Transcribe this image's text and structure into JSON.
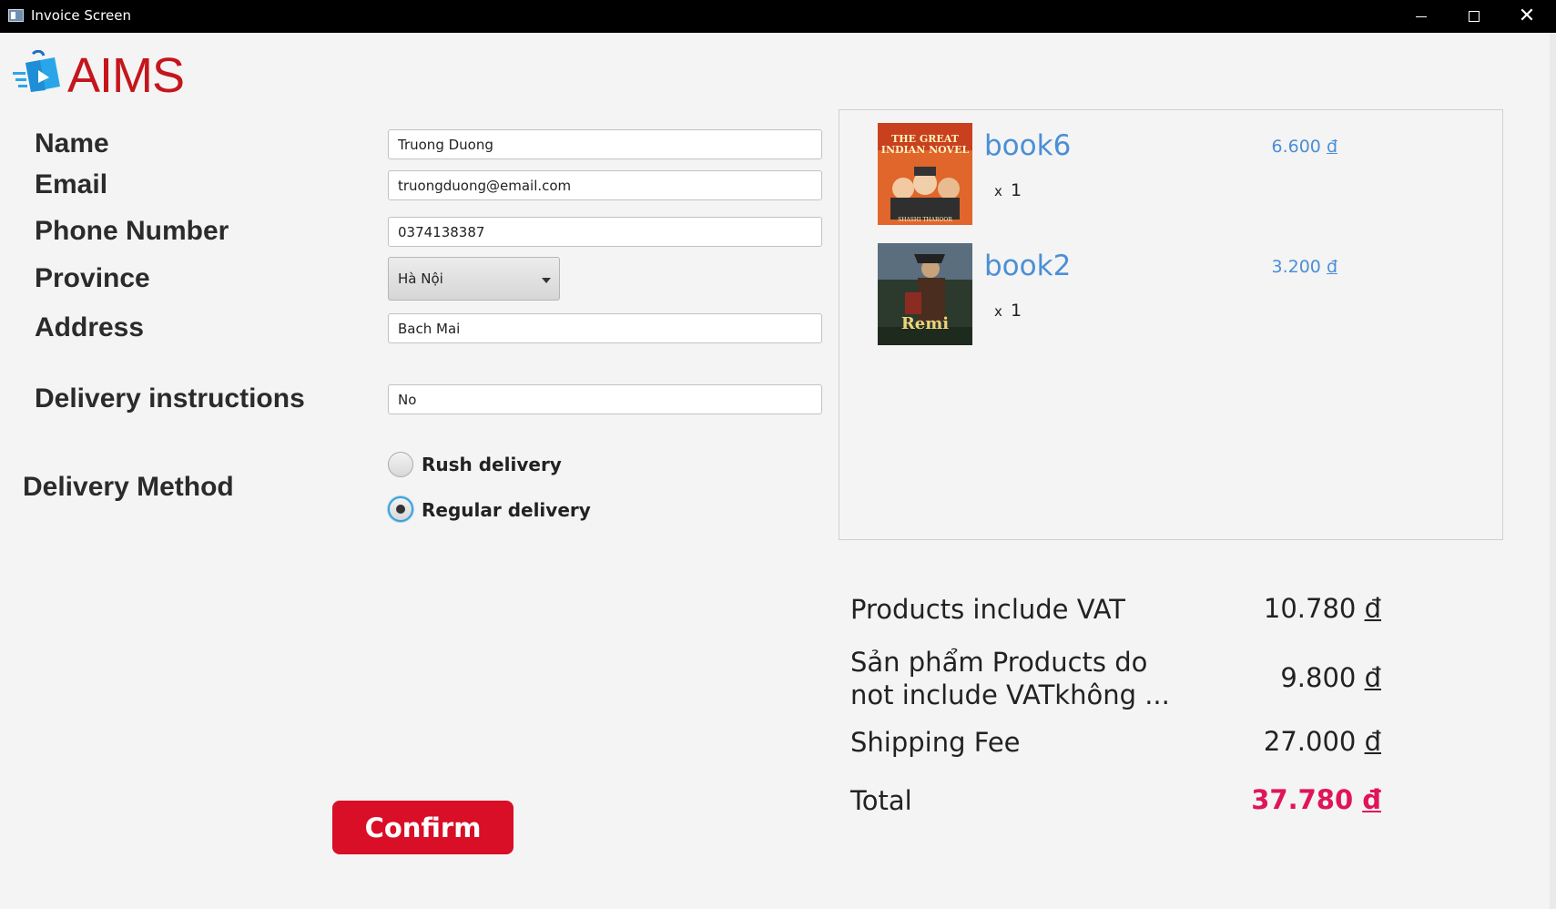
{
  "window": {
    "title": "Invoice Screen"
  },
  "brand": {
    "name": "AIMS",
    "color": "#c4161c"
  },
  "form": {
    "name": {
      "label": "Name",
      "value": "Truong Duong"
    },
    "email": {
      "label": "Email",
      "value": "truongduong@email.com"
    },
    "phone": {
      "label": "Phone Number",
      "value": "0374138387"
    },
    "province": {
      "label": "Province",
      "value": "Hà Nội"
    },
    "address": {
      "label": "Address",
      "value": "Bach Mai"
    },
    "instructions": {
      "label": "Delivery instructions",
      "value": "No"
    },
    "delivery_method": {
      "label": "Delivery Method",
      "options": [
        {
          "label": "Rush delivery",
          "selected": false
        },
        {
          "label": "Regular delivery",
          "selected": true
        }
      ]
    }
  },
  "cart": {
    "items": [
      {
        "name": "book6",
        "price": "6.600 ",
        "currency": "đ",
        "qty_prefix": "x",
        "qty": "1",
        "cover_title": "THE GREAT INDIAN NOVEL",
        "cover_author": "SHASHI THAROOR"
      },
      {
        "name": "book2",
        "price": "3.200 ",
        "currency": "đ",
        "qty_prefix": "x",
        "qty": "1",
        "cover_title": "Remi"
      }
    ]
  },
  "summary": {
    "vat": {
      "label": "Products include VAT",
      "value": "10.780 ",
      "currency": "đ"
    },
    "no_vat": {
      "label": "Sản phẩm Products do not include VATkhông ...",
      "value": "9.800 ",
      "currency": "đ"
    },
    "shipping": {
      "label": "Shipping Fee",
      "value": "27.000 ",
      "currency": "đ"
    },
    "total": {
      "label": "Total",
      "value": "37.780 ",
      "currency": "đ",
      "color": "#e0145a"
    }
  },
  "actions": {
    "confirm_label": "Confirm"
  }
}
